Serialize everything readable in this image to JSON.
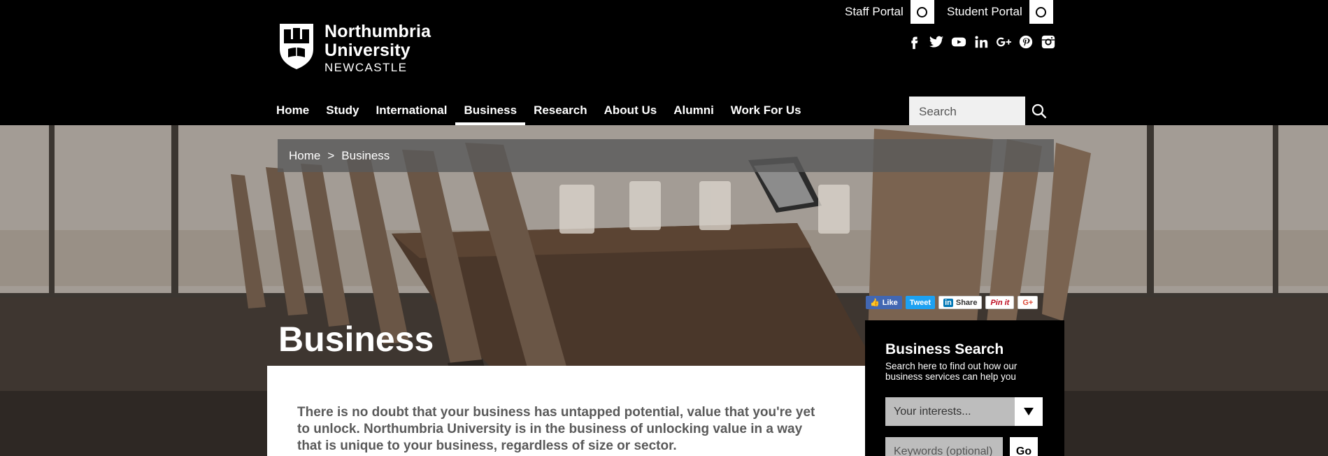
{
  "header": {
    "logo": {
      "line1": "Northumbria",
      "line2": "University",
      "line3": "NEWCASTLE"
    },
    "portals": [
      {
        "label": "Staff Portal"
      },
      {
        "label": "Student Portal"
      }
    ],
    "social_icons": [
      "facebook-icon",
      "twitter-icon",
      "youtube-icon",
      "linkedin-icon",
      "google-plus-icon",
      "pinterest-icon",
      "instagram-icon"
    ],
    "nav": [
      {
        "label": "Home"
      },
      {
        "label": "Study"
      },
      {
        "label": "International"
      },
      {
        "label": "Business",
        "active": true
      },
      {
        "label": "Research"
      },
      {
        "label": "About Us"
      },
      {
        "label": "Alumni"
      },
      {
        "label": "Work For Us"
      }
    ],
    "search": {
      "placeholder": "Search"
    }
  },
  "breadcrumb": {
    "home": "Home",
    "separator": ">",
    "current": "Business"
  },
  "share": {
    "like": "Like",
    "tweet": "Tweet",
    "linkedin": "Share",
    "pinterest": "Pin it",
    "gplus": "G+"
  },
  "page": {
    "title": "Business",
    "intro": "There is no doubt that your business has untapped potential, value that you're yet to unlock. Northumbria University is in the business of unlocking value in a way that is unique to your business, regardless of size or sector."
  },
  "business_search": {
    "title": "Business Search",
    "subtitle": "Search here to find out how our business services can help you",
    "select_value": "Your interests...",
    "keywords_placeholder": "Keywords (optional)",
    "go_label": "Go"
  },
  "colors": {
    "header_bg": "#000000",
    "breadcrumb_bg": "#5a5a5a",
    "intro_text": "#5a5a5a"
  }
}
